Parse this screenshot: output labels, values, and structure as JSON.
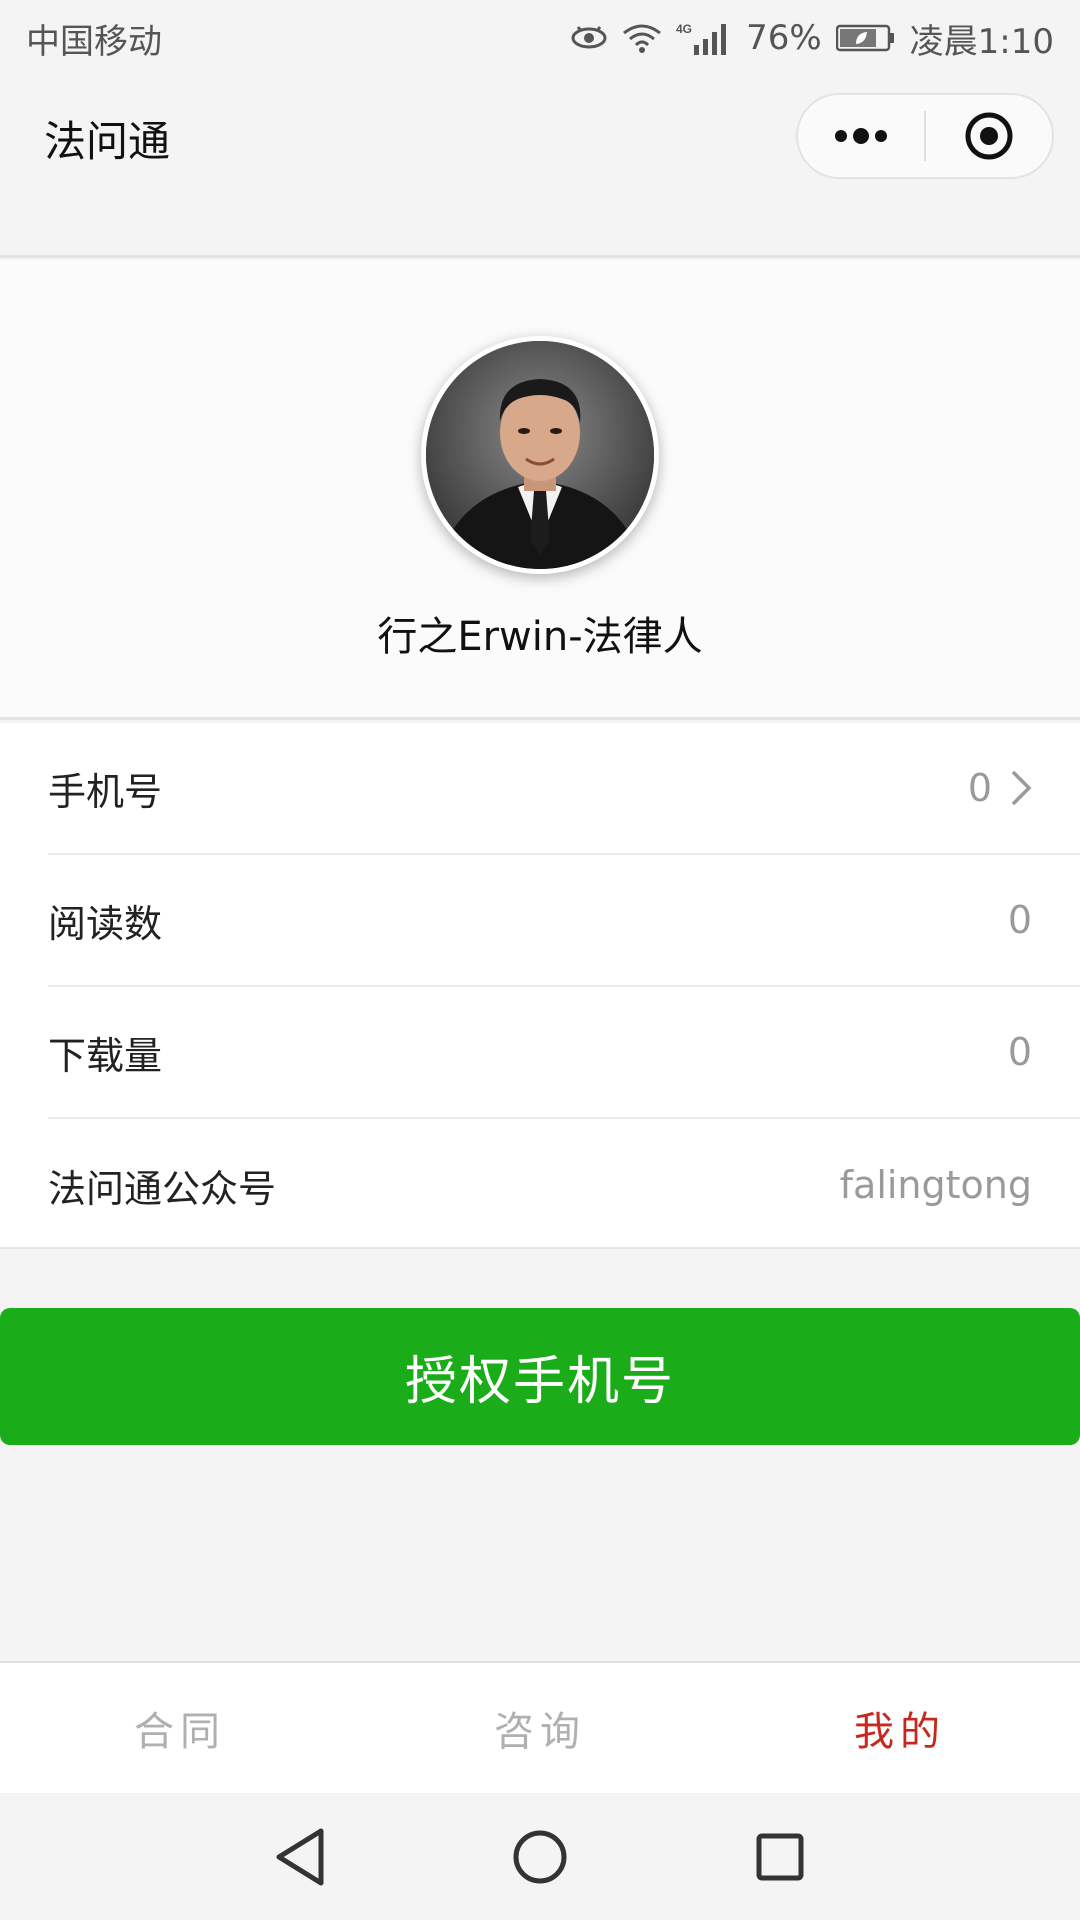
{
  "status_bar": {
    "carrier": "中国移动",
    "network": "4G",
    "battery": "76%",
    "time": "凌晨1:10"
  },
  "nav": {
    "title": "法问通",
    "more_icon": "more-dots-icon",
    "close_icon": "target-circle-icon"
  },
  "profile": {
    "name": "行之Erwin-法律人"
  },
  "list": {
    "items": [
      {
        "label": "手机号",
        "value": "0",
        "chevron": true
      },
      {
        "label": "阅读数",
        "value": "0"
      },
      {
        "label": "下载量",
        "value": "0"
      },
      {
        "label": "法问通公众号",
        "value": "falingtong"
      }
    ]
  },
  "button": {
    "label": "授权手机号",
    "color": "#1aad19"
  },
  "tabbar": {
    "tabs": [
      {
        "label": "合同"
      },
      {
        "label": "咨询"
      },
      {
        "label": "我的",
        "active": true
      }
    ],
    "active_color": "#c8281c"
  }
}
